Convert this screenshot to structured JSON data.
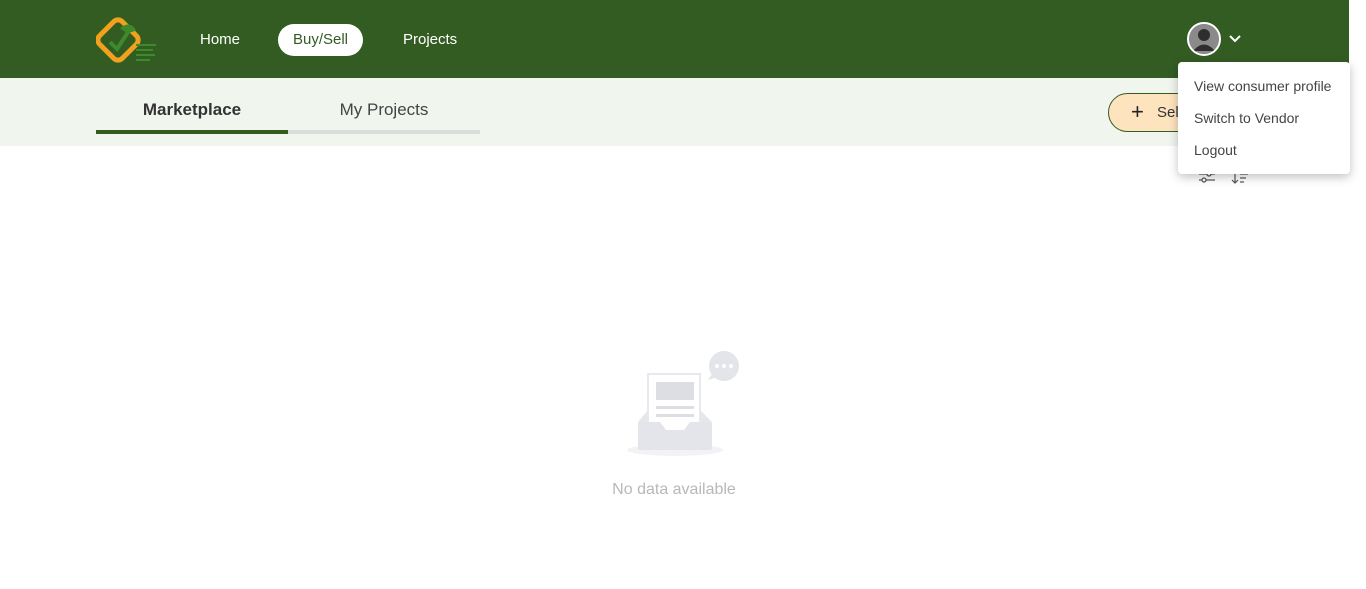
{
  "header": {
    "nav": [
      {
        "label": "Home"
      },
      {
        "label": "Buy/Sell"
      },
      {
        "label": "Projects"
      }
    ],
    "active_nav": "Buy/Sell"
  },
  "tabs": [
    {
      "label": "Marketplace",
      "active": true
    },
    {
      "label": "My Projects",
      "active": false
    }
  ],
  "actions": {
    "sell_label": "Sel"
  },
  "user_menu": {
    "items": [
      {
        "label": "View consumer profile"
      },
      {
        "label": "Switch to Vendor"
      },
      {
        "label": "Logout"
      }
    ]
  },
  "empty_state": {
    "text": "No data available"
  },
  "colors": {
    "brand_green": "#335c23",
    "subbar_bg": "#f0f5ee",
    "sell_button_bg": "#fde4bf",
    "logo_orange": "#f0a21e"
  },
  "icons": [
    "logo",
    "user-avatar-icon",
    "chevron-down-icon",
    "plus-icon",
    "filter-icon",
    "sort-icon",
    "empty-inbox-icon"
  ]
}
